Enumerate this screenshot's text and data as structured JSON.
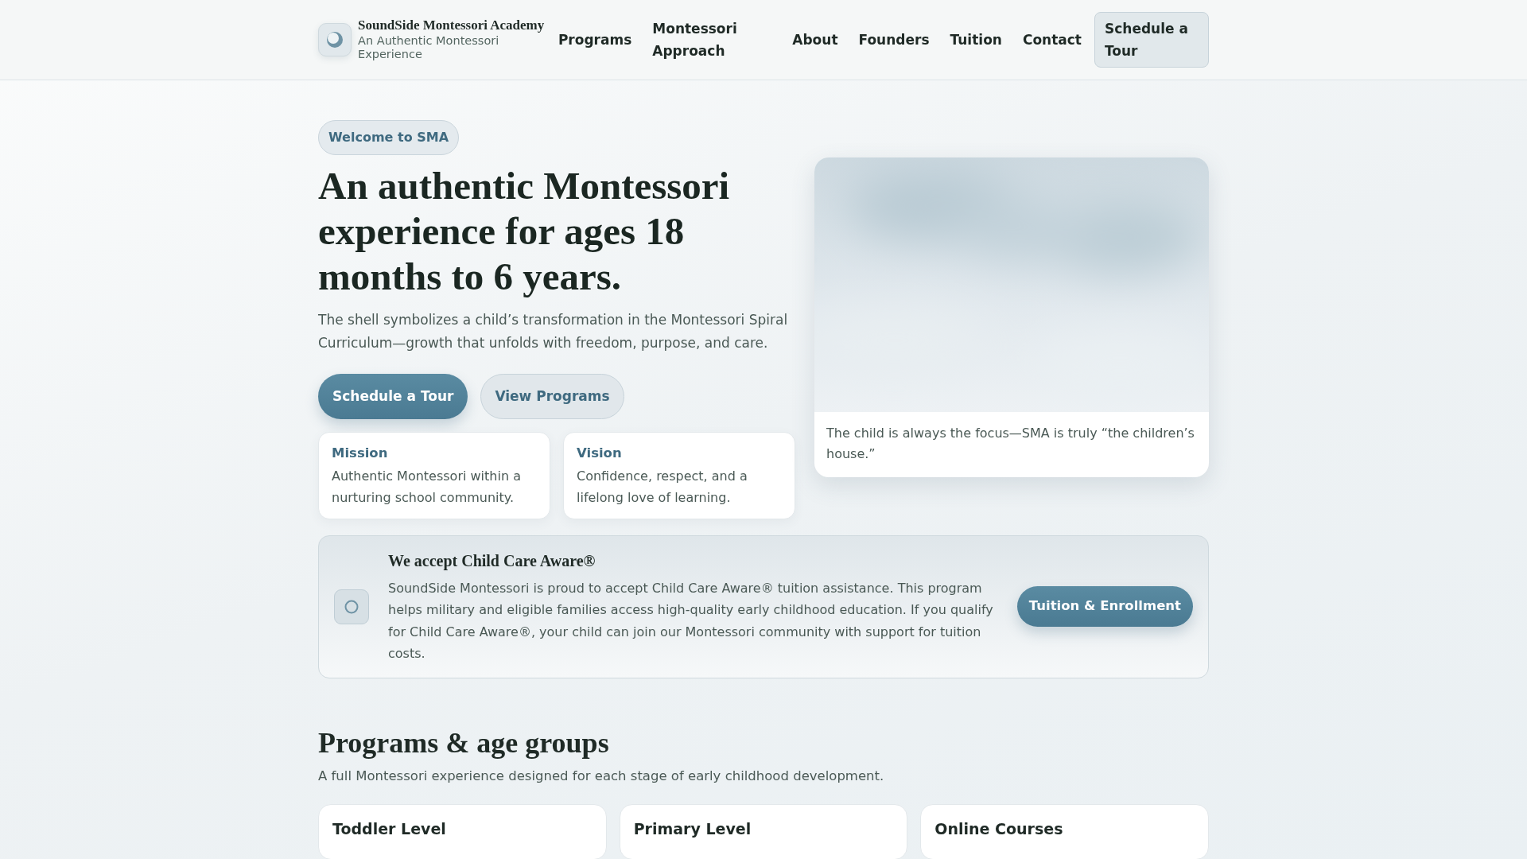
{
  "header": {
    "brand": {
      "name": "SoundSide Montessori Academy",
      "tagline": "An Authentic Montessori Experience"
    },
    "nav": [
      {
        "label": "Programs"
      },
      {
        "label": "Montessori Approach"
      },
      {
        "label": "About"
      },
      {
        "label": "Founders"
      },
      {
        "label": "Tuition"
      },
      {
        "label": "Contact"
      }
    ],
    "cta": "Schedule a Tour"
  },
  "hero": {
    "badge": "Welcome to SMA",
    "heading": "An authentic Montessori experience for ages 18 months to 6 years.",
    "lead": "The shell symbolizes a child’s transformation in the Montessori Spiral Curriculum—growth that unfolds with freedom, purpose, and care.",
    "buttons": [
      {
        "label": "Schedule a Tour",
        "kind": "primary"
      },
      {
        "label": "View Programs",
        "kind": "secondary"
      }
    ],
    "cards": [
      {
        "title": "Mission",
        "text": "Authentic Montessori within a nurturing school community."
      },
      {
        "title": "Vision",
        "text": "Confidence, respect, and a lifelong love of learning."
      }
    ],
    "photo": {
      "kind": "picture",
      "caption": "The child is always the focus—SMA is truly “the children’s house.”"
    }
  },
  "notice": {
    "title": "We accept Child Care Aware®",
    "text": "SoundSide Montessori is proud to accept Child Care Aware® tuition assistance. This program helps military and eligible families access high-quality early childhood education. If you qualify for Child Care Aware®, your child can join our Montessori community with support for tuition costs.",
    "button": "Tuition & Enrollment"
  },
  "programs": {
    "heading": "Programs & age groups",
    "subtitle": "A full Montessori experience designed for each stage of early childhood development.",
    "cards": [
      {
        "title": "Toddler Level"
      },
      {
        "title": "Primary Level"
      },
      {
        "title": "Online Courses"
      }
    ]
  }
}
